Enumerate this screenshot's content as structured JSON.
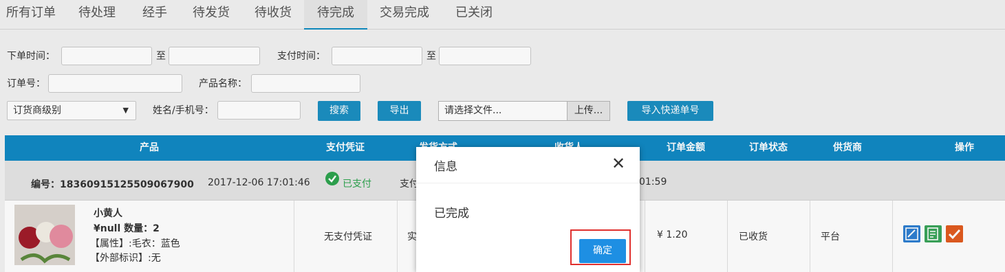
{
  "tabs": [
    {
      "label": "所有订单"
    },
    {
      "label": "待处理"
    },
    {
      "label": "经手"
    },
    {
      "label": "待发货"
    },
    {
      "label": "待收货"
    },
    {
      "label": "待完成",
      "active": true
    },
    {
      "label": "交易完成"
    },
    {
      "label": "已关闭"
    }
  ],
  "filters": {
    "order_time_label": "下单时间：",
    "to_label": "至",
    "pay_time_label": "支付时间：",
    "order_no_label": "订单号：",
    "product_name_label": "产品名称：",
    "supplier_level_select": "订货商级别",
    "name_phone_label": "姓名/手机号：",
    "search_button": "搜索",
    "export_button": "导出",
    "file_placeholder": "请选择文件...",
    "upload_button": "上传...",
    "import_button": "导入快递单号"
  },
  "table": {
    "headers": [
      "产品",
      "支付凭证",
      "发货方式",
      "收货人",
      "订单金额",
      "订单状态",
      "供货商",
      "操作"
    ],
    "order": {
      "number": "编号：18360915125509067900",
      "time": "2017-12-06 17:01:46",
      "pay_status": "已支付",
      "pay_method_partial": "支付",
      "time_partial": "01:59"
    },
    "product": {
      "name": "小黄人",
      "price_qty": "¥null 数量：2",
      "attr": "【属性】:毛衣：蓝色",
      "ext_id": "【外部标识】:无",
      "pay_proof": "无支付凭证",
      "ship_partial": "实",
      "amount": "¥ 1.20",
      "status": "已收货",
      "supplier": "平台"
    },
    "op_icon_colors": [
      "#2f7fd1",
      "#3aa55a",
      "#e25b1f"
    ]
  },
  "dialog": {
    "title": "信息",
    "message": "已完成",
    "ok_button": "确定"
  }
}
